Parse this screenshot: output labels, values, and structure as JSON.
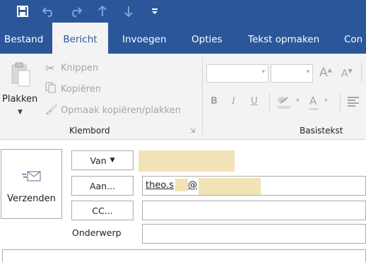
{
  "quick_access": {
    "icons": [
      "save-icon",
      "undo-icon",
      "redo-icon",
      "up-arrow-icon",
      "down-arrow-icon",
      "customize-icon"
    ]
  },
  "tabs": [
    {
      "label": "Bestand"
    },
    {
      "label": "Bericht"
    },
    {
      "label": "Invoegen"
    },
    {
      "label": "Opties"
    },
    {
      "label": "Tekst opmaken"
    },
    {
      "label": "Con"
    }
  ],
  "ribbon": {
    "paste_label": "Plakken",
    "cut_label": "Knippen",
    "copy_label": "Kopiëren",
    "format_painter_label": "Opmaak kopiëren/plakken",
    "clipboard_group": "Klembord",
    "basic_text_group": "Basistekst",
    "bold": "B",
    "italic": "I",
    "underline": "U",
    "font_size_increase": "A",
    "font_size_decrease": "A",
    "font_color": "A"
  },
  "compose": {
    "send_label": "Verzenden",
    "from_label": "Van",
    "to_label": "Aan...",
    "cc_label": "CC...",
    "subject_label": "Onderwerp",
    "to_value_prefix": "theo.s",
    "to_value_suffix": "@",
    "from_value": "",
    "cc_value": "",
    "subject_value": ""
  },
  "colors": {
    "brand": "#2b579a",
    "ribbon": "#f3f3f3",
    "redaction": "#f1e3b5"
  }
}
